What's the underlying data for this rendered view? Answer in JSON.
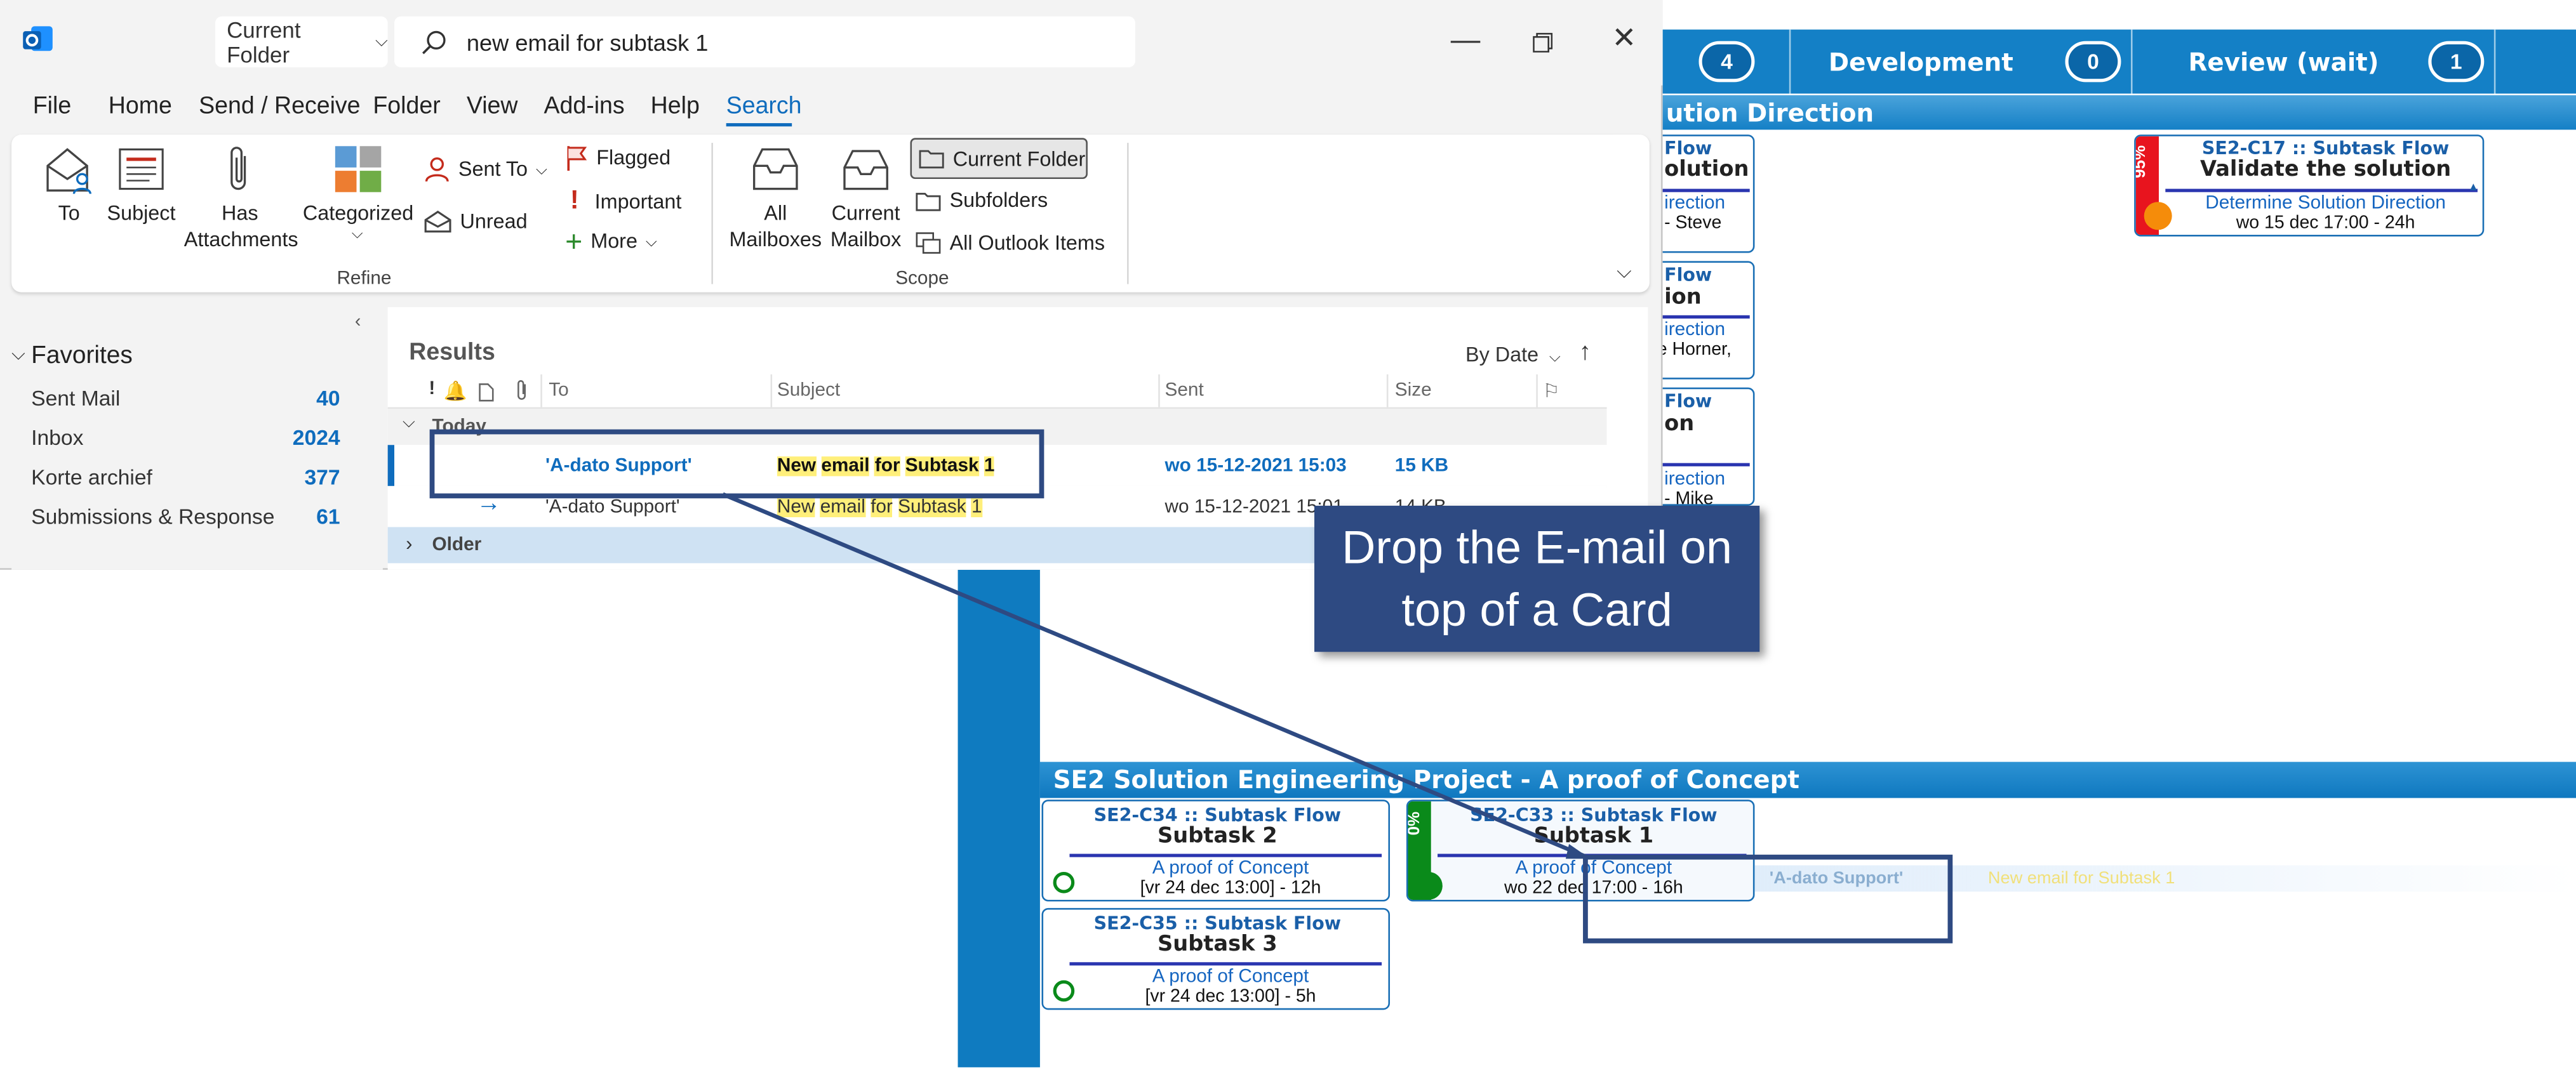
{
  "kanban": {
    "columns": [
      {
        "title": "Development",
        "count": "0"
      },
      {
        "title": "Review (wait)",
        "count": "1"
      }
    ],
    "partial_count": "4",
    "swimlane_top": "ution Direction",
    "swimlane_bottom": "SE2 Solution Engineering Project -  A proof of Concept",
    "partial_cards": [
      {
        "line1": "Flow",
        "line2": "olution",
        "line3": "irection",
        "line4": "- Steve"
      },
      {
        "line1": "Flow",
        "line2": "ion",
        "line3": "irection",
        "line4": "eve Horner,"
      },
      {
        "line1": "Flow",
        "line2": "on",
        "line3": "irection",
        "line4": "- Mike"
      }
    ],
    "cards": [
      {
        "id": "SE2-C17 :: Subtask Flow",
        "title": "Validate the solution",
        "parent": "Determine Solution Direction",
        "date": "wo 15 dec 17:00 - 24h",
        "progress": "95%"
      },
      {
        "id": "SE2-C34 :: Subtask Flow",
        "title": "Subtask 2",
        "parent": "A proof of Concept",
        "date": "[vr 24 dec 13:00] - 12h"
      },
      {
        "id": "SE2-C33 :: Subtask Flow",
        "title": "Subtask 1",
        "parent": "A proof of Concept",
        "date": "wo 22 dec 17:00 - 16h",
        "progress": "0%"
      },
      {
        "id": "SE2-C35 :: Subtask Flow",
        "title": "Subtask 3",
        "parent": "A proof of Concept",
        "date": "[vr 24 dec 13:00] - 5h"
      }
    ],
    "drag_ghost": {
      "to": "'A-dato Support'",
      "subject": "New email for Subtask 1"
    }
  },
  "outlook": {
    "scope_dropdown": "Current Folder",
    "search_query": "new email for subtask 1",
    "menu": [
      "File",
      "Home",
      "Send / Receive",
      "Folder",
      "View",
      "Add-ins",
      "Help",
      "Search"
    ],
    "ribbon": {
      "refine": {
        "group": "Refine",
        "to": "To",
        "subject": "Subject",
        "has_attachments_1": "Has",
        "has_attachments_2": "Attachments",
        "categorized": "Categorized",
        "sent_to": "Sent To",
        "unread": "Unread",
        "flagged": "Flagged",
        "important": "Important",
        "more": "More"
      },
      "scope": {
        "group": "Scope",
        "all_mailboxes_1": "All",
        "all_mailboxes_2": "Mailboxes",
        "current_mailbox_1": "Current",
        "current_mailbox_2": "Mailbox",
        "current_folder": "Current Folder",
        "subfolders": "Subfolders",
        "all_outlook_items": "All Outlook Items"
      }
    },
    "favorites": {
      "title": "Favorites",
      "items": [
        {
          "label": "Sent Mail",
          "count": "40"
        },
        {
          "label": "Inbox",
          "count": "2024"
        },
        {
          "label": "Korte archief",
          "count": "377"
        },
        {
          "label": "Submissions & Response",
          "count": "61"
        }
      ]
    },
    "results": {
      "title": "Results",
      "sort": "By Date",
      "columns": {
        "to": "To",
        "subject": "Subject",
        "sent": "Sent",
        "size": "Size"
      },
      "group_today": "Today",
      "group_older": "Older",
      "rows": [
        {
          "to": "'A-dato Support'",
          "subject_words": [
            "New",
            "email",
            "for",
            "Subtask",
            "1"
          ],
          "sent": "wo 15-12-2021 15:03",
          "size": "15 KB"
        },
        {
          "to": "'A-dato Support'",
          "subject_words": [
            "New",
            "email",
            "for",
            "Subtask",
            "1"
          ],
          "sent": "wo 15-12-2021 15:01",
          "size": "14 KB"
        }
      ]
    }
  },
  "callout": {
    "line1": "Drop the E-mail on",
    "line2": "top of a Card"
  },
  "colors": {
    "accent": "#0f6cbd",
    "board_blue": "#1480c6",
    "callout": "#2e4a82",
    "highlight": "#ffef7a"
  }
}
